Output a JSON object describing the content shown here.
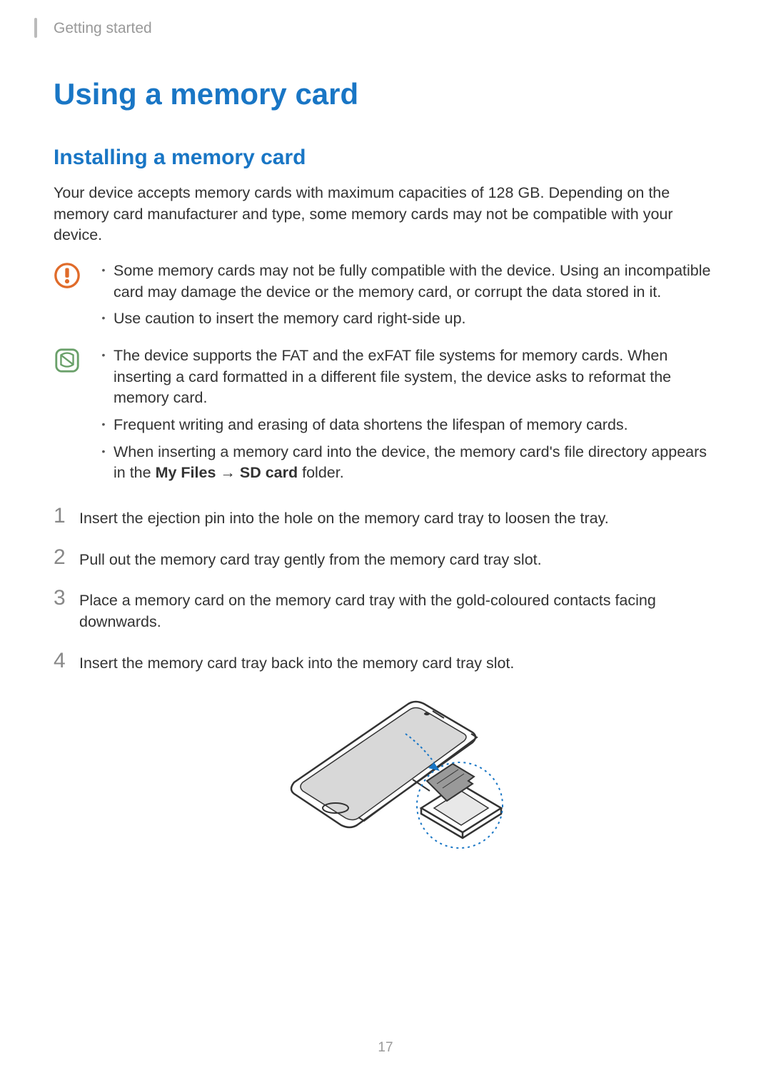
{
  "section": "Getting started",
  "title": "Using a memory card",
  "subtitle": "Installing a memory card",
  "intro": "Your device accepts memory cards with maximum capacities of 128 GB. Depending on the memory card manufacturer and type, some memory cards may not be compatible with your device.",
  "caution": {
    "items": [
      "Some memory cards may not be fully compatible with the device. Using an incompatible card may damage the device or the memory card, or corrupt the data stored in it.",
      "Use caution to insert the memory card right-side up."
    ]
  },
  "note": {
    "items": [
      "The device supports the FAT and the exFAT file systems for memory cards. When inserting a card formatted in a different file system, the device asks to reformat the memory card.",
      "Frequent writing and erasing of data shortens the lifespan of memory cards."
    ],
    "item_with_bold": {
      "prefix": "When inserting a memory card into the device, the memory card's file directory appears in the ",
      "bold1": "My Files",
      "arrow": " → ",
      "bold2": "SD card",
      "suffix": " folder."
    }
  },
  "steps": [
    "Insert the ejection pin into the hole on the memory card tray to loosen the tray.",
    "Pull out the memory card tray gently from the memory card tray slot.",
    "Place a memory card on the memory card tray with the gold-coloured contacts facing downwards.",
    "Insert the memory card tray back into the memory card tray slot."
  ],
  "step_numbers": [
    "1",
    "2",
    "3",
    "4"
  ],
  "page_number": "17"
}
